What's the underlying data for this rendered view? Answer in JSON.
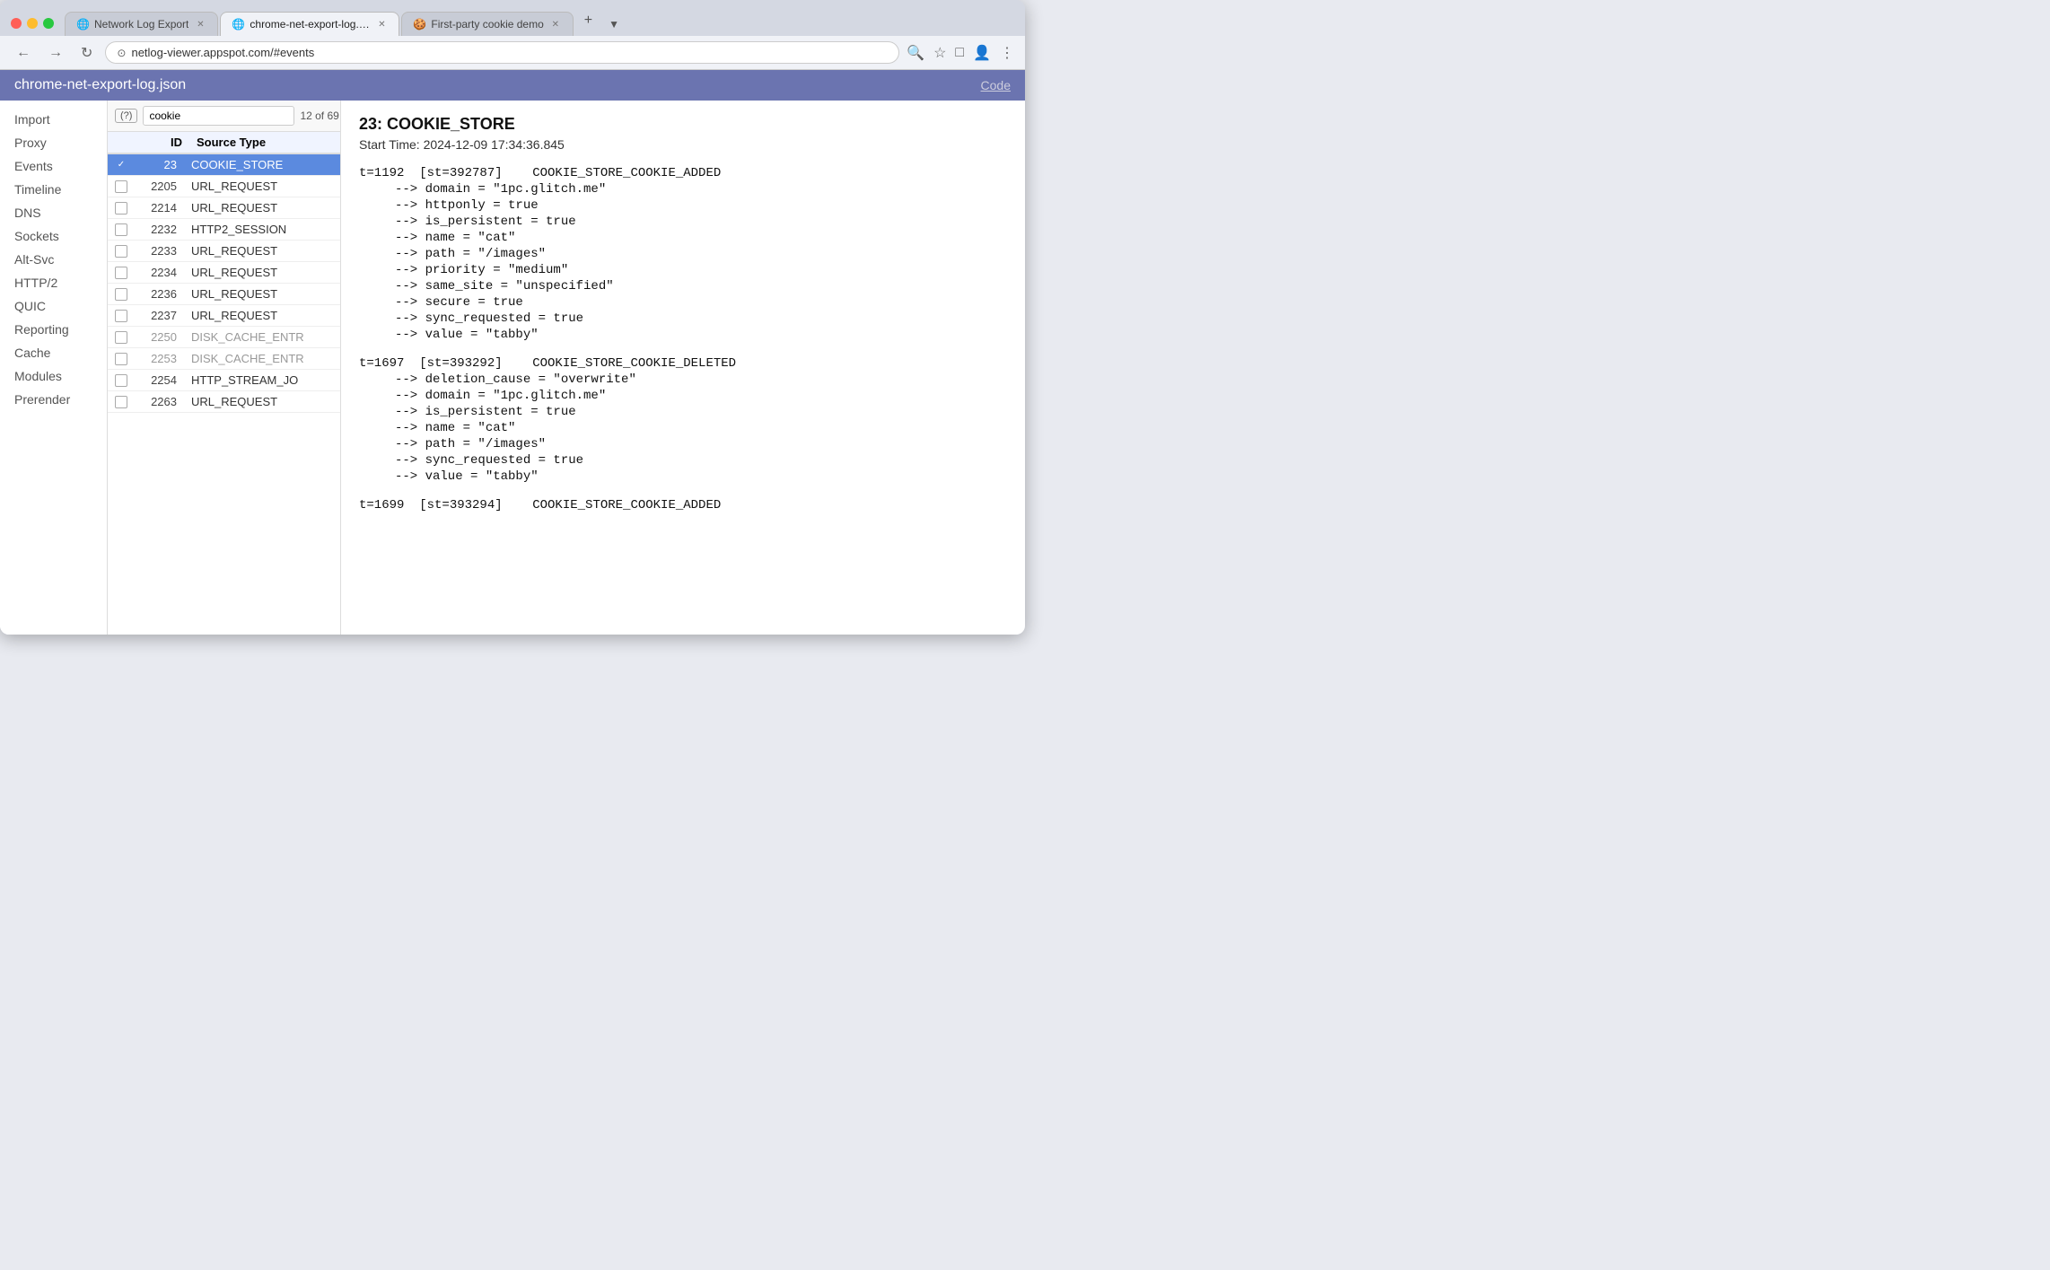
{
  "browser": {
    "tabs": [
      {
        "id": "tab1",
        "label": "Network Log Export",
        "icon": "🌐",
        "active": false
      },
      {
        "id": "tab2",
        "label": "chrome-net-export-log.json -",
        "icon": "🌐",
        "active": true
      },
      {
        "id": "tab3",
        "label": "First-party cookie demo",
        "icon": "🍪",
        "active": false
      }
    ],
    "address": "netlog-viewer.appspot.com/#events"
  },
  "app": {
    "title": "chrome-net-export-log.json",
    "code_link": "Code"
  },
  "sidebar": {
    "items": [
      "Import",
      "Proxy",
      "Events",
      "Timeline",
      "DNS",
      "Sockets",
      "Alt-Svc",
      "HTTP/2",
      "QUIC",
      "Reporting",
      "Cache",
      "Modules",
      "Prerender"
    ]
  },
  "events": {
    "search_value": "cookie",
    "count": "12 of 69",
    "columns": {
      "id": "ID",
      "source_type": "Source Type"
    },
    "rows": [
      {
        "id": "23",
        "source": "COOKIE_STORE",
        "selected": true,
        "checked": true
      },
      {
        "id": "2205",
        "source": "URL_REQUEST",
        "selected": false,
        "checked": false
      },
      {
        "id": "2214",
        "source": "URL_REQUEST",
        "selected": false,
        "checked": false
      },
      {
        "id": "2232",
        "source": "HTTP2_SESSION",
        "selected": false,
        "checked": false
      },
      {
        "id": "2233",
        "source": "URL_REQUEST",
        "selected": false,
        "checked": false
      },
      {
        "id": "2234",
        "source": "URL_REQUEST",
        "selected": false,
        "checked": false
      },
      {
        "id": "2236",
        "source": "URL_REQUEST",
        "selected": false,
        "checked": false
      },
      {
        "id": "2237",
        "source": "URL_REQUEST",
        "selected": false,
        "checked": false
      },
      {
        "id": "2250",
        "source": "DISK_CACHE_ENTR",
        "selected": false,
        "checked": false,
        "gray": true
      },
      {
        "id": "2253",
        "source": "DISK_CACHE_ENTR",
        "selected": false,
        "checked": false,
        "gray": true
      },
      {
        "id": "2254",
        "source": "HTTP_STREAM_JO",
        "selected": false,
        "checked": false
      },
      {
        "id": "2263",
        "source": "URL_REQUEST",
        "selected": false,
        "checked": false
      }
    ]
  },
  "detail": {
    "title": "23: COOKIE_STORE",
    "start_time": "Start Time: 2024-12-09 17:34:36.845",
    "blocks": [
      {
        "header": "t=1192  [st=392787]    COOKIE_STORE_COOKIE_ADDED",
        "lines": [
          "--> domain = \"1pc.glitch.me\"",
          "--> httponly = true",
          "--> is_persistent = true",
          "--> name = \"cat\"",
          "--> path = \"/images\"",
          "--> priority = \"medium\"",
          "--> same_site = \"unspecified\"",
          "--> secure = true",
          "--> sync_requested = true",
          "--> value = \"tabby\""
        ]
      },
      {
        "header": "t=1697  [st=393292]    COOKIE_STORE_COOKIE_DELETED",
        "lines": [
          "--> deletion_cause = \"overwrite\"",
          "--> domain = \"1pc.glitch.me\"",
          "--> is_persistent = true",
          "--> name = \"cat\"",
          "--> path = \"/images\"",
          "--> sync_requested = true",
          "--> value = \"tabby\""
        ]
      },
      {
        "header": "t=1699  [st=393294]    COOKIE_STORE_COOKIE_ADDED",
        "lines": []
      }
    ]
  }
}
